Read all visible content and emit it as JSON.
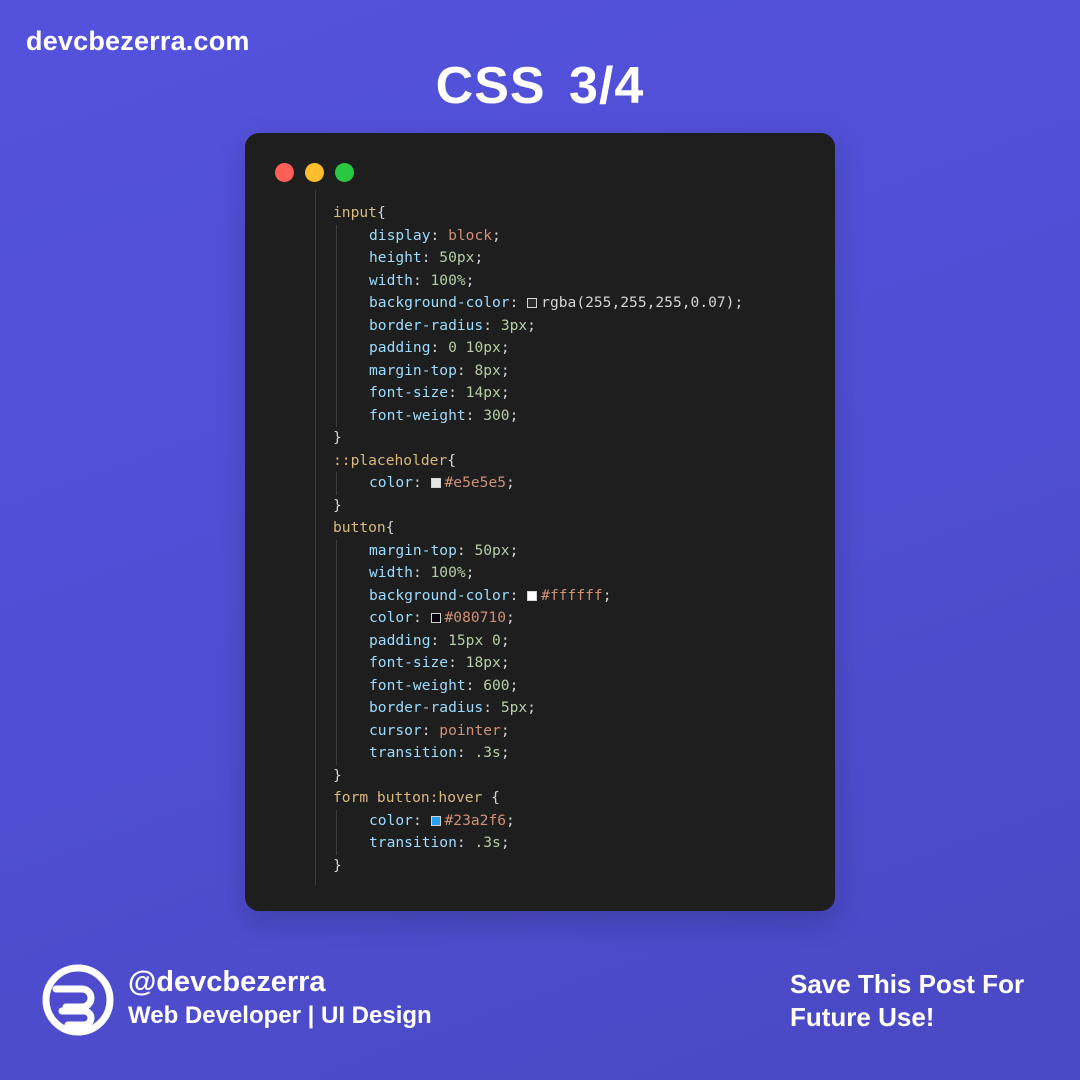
{
  "header": {
    "site": "devcbezerra.com",
    "title": "CSS  3/4"
  },
  "window": {
    "dots": [
      {
        "name": "close",
        "color": "#ff5f57"
      },
      {
        "name": "minimize",
        "color": "#febc2e"
      },
      {
        "name": "maximize",
        "color": "#28c840"
      }
    ]
  },
  "code": {
    "lines": [
      {
        "indent": 0,
        "tokens": [
          {
            "t": "input",
            "c": "sel"
          },
          {
            "t": "{",
            "c": "brace"
          }
        ]
      },
      {
        "indent": 1,
        "tokens": [
          {
            "t": "display",
            "c": "prop"
          },
          {
            "t": ": ",
            "c": "punct"
          },
          {
            "t": "block",
            "c": "val-str"
          },
          {
            "t": ";",
            "c": "punct"
          }
        ]
      },
      {
        "indent": 1,
        "tokens": [
          {
            "t": "height",
            "c": "prop"
          },
          {
            "t": ": ",
            "c": "punct"
          },
          {
            "t": "50px",
            "c": "val-num"
          },
          {
            "t": ";",
            "c": "punct"
          }
        ]
      },
      {
        "indent": 1,
        "tokens": [
          {
            "t": "width",
            "c": "prop"
          },
          {
            "t": ": ",
            "c": "punct"
          },
          {
            "t": "100%",
            "c": "val-num"
          },
          {
            "t": ";",
            "c": "punct"
          }
        ]
      },
      {
        "indent": 1,
        "tokens": [
          {
            "t": "background-color",
            "c": "prop"
          },
          {
            "t": ": ",
            "c": "punct"
          },
          {
            "swatch": "rgba(255,255,255,0.07)"
          },
          {
            "t": "rgba(255,255,255,0.07)",
            "c": "punct"
          },
          {
            "t": ";",
            "c": "punct"
          }
        ]
      },
      {
        "indent": 1,
        "tokens": [
          {
            "t": "border-radius",
            "c": "prop"
          },
          {
            "t": ": ",
            "c": "punct"
          },
          {
            "t": "3px",
            "c": "val-num"
          },
          {
            "t": ";",
            "c": "punct"
          }
        ]
      },
      {
        "indent": 1,
        "tokens": [
          {
            "t": "padding",
            "c": "prop"
          },
          {
            "t": ": ",
            "c": "punct"
          },
          {
            "t": "0 10px",
            "c": "val-num"
          },
          {
            "t": ";",
            "c": "punct"
          }
        ]
      },
      {
        "indent": 1,
        "tokens": [
          {
            "t": "margin-top",
            "c": "prop"
          },
          {
            "t": ": ",
            "c": "punct"
          },
          {
            "t": "8px",
            "c": "val-num"
          },
          {
            "t": ";",
            "c": "punct"
          }
        ]
      },
      {
        "indent": 1,
        "tokens": [
          {
            "t": "font-size",
            "c": "prop"
          },
          {
            "t": ": ",
            "c": "punct"
          },
          {
            "t": "14px",
            "c": "val-num"
          },
          {
            "t": ";",
            "c": "punct"
          }
        ]
      },
      {
        "indent": 1,
        "tokens": [
          {
            "t": "font-weight",
            "c": "prop"
          },
          {
            "t": ": ",
            "c": "punct"
          },
          {
            "t": "300",
            "c": "val-num"
          },
          {
            "t": ";",
            "c": "punct"
          }
        ]
      },
      {
        "indent": 0,
        "tokens": [
          {
            "t": "}",
            "c": "brace"
          }
        ]
      },
      {
        "indent": 0,
        "tokens": [
          {
            "t": "::placeholder",
            "c": "sel"
          },
          {
            "t": "{",
            "c": "brace"
          }
        ]
      },
      {
        "indent": 1,
        "tokens": [
          {
            "t": "color",
            "c": "prop"
          },
          {
            "t": ": ",
            "c": "punct"
          },
          {
            "swatch": "#e5e5e5"
          },
          {
            "t": "#e5e5e5",
            "c": "val-str"
          },
          {
            "t": ";",
            "c": "punct"
          }
        ]
      },
      {
        "indent": 0,
        "tokens": [
          {
            "t": "}",
            "c": "brace"
          }
        ]
      },
      {
        "indent": 0,
        "tokens": [
          {
            "t": "button",
            "c": "sel"
          },
          {
            "t": "{",
            "c": "brace"
          }
        ]
      },
      {
        "indent": 1,
        "tokens": [
          {
            "t": "margin-top",
            "c": "prop"
          },
          {
            "t": ": ",
            "c": "punct"
          },
          {
            "t": "50px",
            "c": "val-num"
          },
          {
            "t": ";",
            "c": "punct"
          }
        ]
      },
      {
        "indent": 1,
        "tokens": [
          {
            "t": "width",
            "c": "prop"
          },
          {
            "t": ": ",
            "c": "punct"
          },
          {
            "t": "100%",
            "c": "val-num"
          },
          {
            "t": ";",
            "c": "punct"
          }
        ]
      },
      {
        "indent": 1,
        "tokens": [
          {
            "t": "background-color",
            "c": "prop"
          },
          {
            "t": ": ",
            "c": "punct"
          },
          {
            "swatch": "#ffffff"
          },
          {
            "t": "#ffffff",
            "c": "val-str"
          },
          {
            "t": ";",
            "c": "punct"
          }
        ]
      },
      {
        "indent": 1,
        "tokens": [
          {
            "t": "color",
            "c": "prop"
          },
          {
            "t": ": ",
            "c": "punct"
          },
          {
            "swatch": "#080710"
          },
          {
            "t": "#080710",
            "c": "val-str"
          },
          {
            "t": ";",
            "c": "punct"
          }
        ]
      },
      {
        "indent": 1,
        "tokens": [
          {
            "t": "padding",
            "c": "prop"
          },
          {
            "t": ": ",
            "c": "punct"
          },
          {
            "t": "15px 0",
            "c": "val-num"
          },
          {
            "t": ";",
            "c": "punct"
          }
        ]
      },
      {
        "indent": 1,
        "tokens": [
          {
            "t": "font-size",
            "c": "prop"
          },
          {
            "t": ": ",
            "c": "punct"
          },
          {
            "t": "18px",
            "c": "val-num"
          },
          {
            "t": ";",
            "c": "punct"
          }
        ]
      },
      {
        "indent": 1,
        "tokens": [
          {
            "t": "font-weight",
            "c": "prop"
          },
          {
            "t": ": ",
            "c": "punct"
          },
          {
            "t": "600",
            "c": "val-num"
          },
          {
            "t": ";",
            "c": "punct"
          }
        ]
      },
      {
        "indent": 1,
        "tokens": [
          {
            "t": "border-radius",
            "c": "prop"
          },
          {
            "t": ": ",
            "c": "punct"
          },
          {
            "t": "5px",
            "c": "val-num"
          },
          {
            "t": ";",
            "c": "punct"
          }
        ]
      },
      {
        "indent": 1,
        "tokens": [
          {
            "t": "cursor",
            "c": "prop"
          },
          {
            "t": ": ",
            "c": "punct"
          },
          {
            "t": "pointer",
            "c": "val-str"
          },
          {
            "t": ";",
            "c": "punct"
          }
        ]
      },
      {
        "indent": 1,
        "tokens": [
          {
            "t": "transition",
            "c": "prop"
          },
          {
            "t": ": ",
            "c": "punct"
          },
          {
            "t": ".3s",
            "c": "val-num"
          },
          {
            "t": ";",
            "c": "punct"
          }
        ]
      },
      {
        "indent": 0,
        "tokens": [
          {
            "t": "}",
            "c": "brace"
          }
        ]
      },
      {
        "indent": 0,
        "tokens": [
          {
            "t": "form button:hover",
            "c": "sel"
          },
          {
            "t": " {",
            "c": "brace"
          }
        ]
      },
      {
        "indent": 1,
        "tokens": [
          {
            "t": "color",
            "c": "prop"
          },
          {
            "t": ": ",
            "c": "punct"
          },
          {
            "swatch": "#23a2f6"
          },
          {
            "t": "#23a2f6",
            "c": "val-str"
          },
          {
            "t": ";",
            "c": "punct"
          }
        ]
      },
      {
        "indent": 1,
        "tokens": [
          {
            "t": "transition",
            "c": "prop"
          },
          {
            "t": ": ",
            "c": "punct"
          },
          {
            "t": ".3s",
            "c": "val-num"
          },
          {
            "t": ";",
            "c": "punct"
          }
        ]
      },
      {
        "indent": 0,
        "tokens": [
          {
            "t": "}",
            "c": "brace"
          }
        ]
      }
    ]
  },
  "footer": {
    "logo_icon": "devcbezerra-logo-icon",
    "handle": "@devcbezerra",
    "role": "Web Developer | UI Design",
    "cta_line1": "Save This Post For",
    "cta_line2": "Future Use!"
  }
}
